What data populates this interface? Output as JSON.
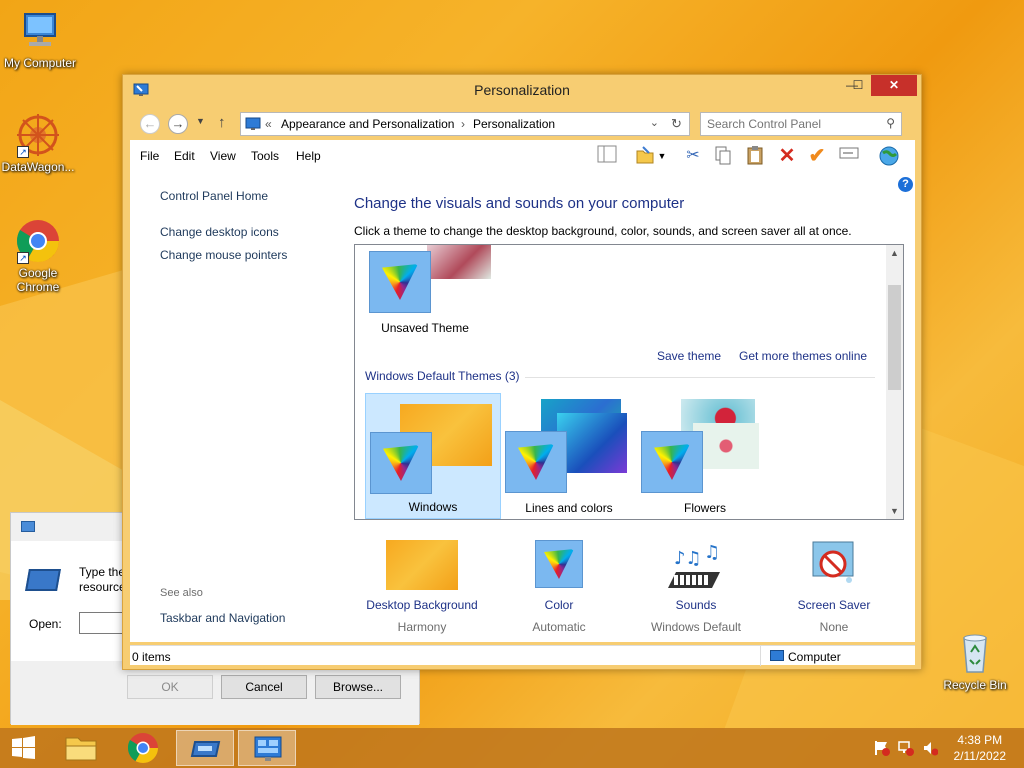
{
  "desktop": {
    "icons": [
      {
        "label": "My Computer"
      },
      {
        "label": "DataWagon..."
      },
      {
        "label": "Google Chrome"
      },
      {
        "label": "Recycle Bin"
      }
    ]
  },
  "run_dialog": {
    "text_line1": "Type the",
    "text_line2": "resource",
    "open_label": "Open:",
    "ok_label": "OK",
    "cancel_label": "Cancel",
    "browse_label": "Browse..."
  },
  "window": {
    "title": "Personalization",
    "controls": {
      "minimize": "—",
      "maximize": "☐",
      "close": "✕"
    },
    "address": {
      "overflow": "«",
      "crumbs": [
        "Appearance and Personalization",
        "Personalization"
      ],
      "separator": "›"
    },
    "search": {
      "placeholder": "Search Control Panel"
    },
    "menu": [
      "File",
      "Edit",
      "View",
      "Tools",
      "Help"
    ],
    "help_icon": "?",
    "left_pane": {
      "home": "Control Panel Home",
      "links": [
        "Change desktop icons",
        "Change mouse pointers"
      ],
      "see_also": "See also",
      "see_also_links": [
        "Taskbar and Navigation"
      ]
    },
    "main": {
      "title": "Change the visuals and sounds on your computer",
      "description": "Click a theme to change the desktop background, color, sounds, and screen saver all at once.",
      "unsaved_theme": "Unsaved Theme",
      "save_theme": "Save theme",
      "get_more": "Get more themes online",
      "section_label": "Windows Default Themes (3)",
      "themes": [
        {
          "name": "Windows",
          "selected": true
        },
        {
          "name": "Lines and colors",
          "selected": false
        },
        {
          "name": "Flowers",
          "selected": false
        }
      ],
      "settings": [
        {
          "link": "Desktop Background",
          "value": "Harmony"
        },
        {
          "link": "Color",
          "value": "Automatic"
        },
        {
          "link": "Sounds",
          "value": "Windows Default"
        },
        {
          "link": "Screen Saver",
          "value": "None"
        }
      ]
    },
    "status": {
      "items": "0 items",
      "location": "Computer"
    }
  },
  "taskbar": {
    "time": "4:38 PM",
    "date": "2/11/2022"
  },
  "colors": {
    "accent_link": "#1e3287",
    "window_frame": "#f7cd72",
    "close_button": "#c7302a",
    "selection": "#cce8ff"
  }
}
